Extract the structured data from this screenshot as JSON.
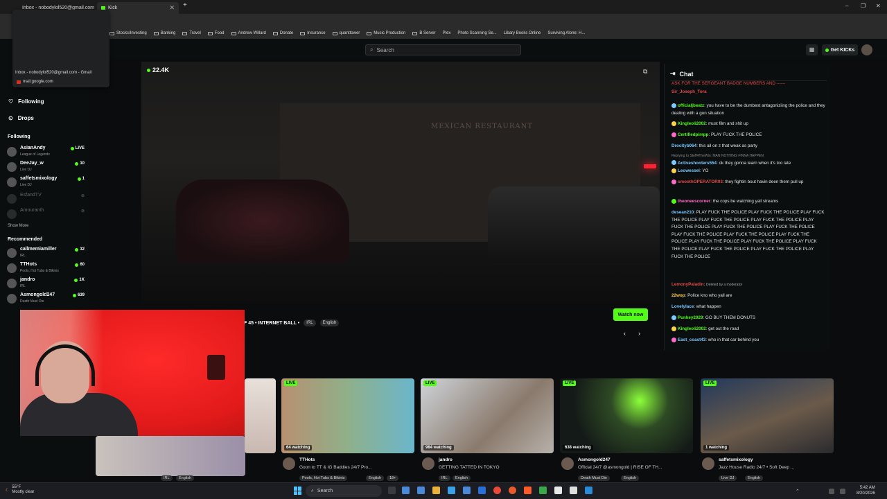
{
  "browser": {
    "tabs": [
      {
        "label": "Inbox - nobodylol520@gmail.com",
        "active": false
      },
      {
        "label": "Kick",
        "active": true
      }
    ],
    "new_tab": "+",
    "window_controls": [
      "–",
      "❐",
      "✕"
    ],
    "bookmarks": [
      "Stocks/Investing",
      "Banking",
      "Travel",
      "Food",
      "Andrew Willard",
      "Donate",
      "Insurance",
      "quanttower",
      "Music Production",
      "B Server",
      "Plex",
      "Photo Scanning Se...",
      "Libary Books Online",
      "Surviving Alone: H..."
    ]
  },
  "tab_tooltip": {
    "title": "Inbox - nobodylol520@gmail.com - Gmail",
    "domain": "mail.google.com"
  },
  "topbar": {
    "search_placeholder": "Search",
    "get_kicks": "Get KICKs"
  },
  "sidebar": {
    "nav": [
      {
        "label": "Following",
        "icon": "heart-icon"
      },
      {
        "label": "Drops",
        "icon": "drops-icon"
      }
    ],
    "following_title": "Following",
    "following": [
      {
        "name": "AsianAndy",
        "category": "League of Legends",
        "viewers": "LIVE",
        "online": true
      },
      {
        "name": "DeeJay_w",
        "category": "Live DJ",
        "viewers": "10",
        "online": true
      },
      {
        "name": "saffetsmixology",
        "category": "Live DJ",
        "viewers": "1",
        "online": true
      },
      {
        "name": "EsfandTV",
        "category": "",
        "viewers": "",
        "online": false
      },
      {
        "name": "Amouranth",
        "category": "",
        "viewers": "",
        "online": false
      }
    ],
    "show_more": "Show More",
    "recommended_title": "Recommended",
    "recommended": [
      {
        "name": "callmemiamiller",
        "category": "IRL",
        "viewers": "32"
      },
      {
        "name": "TTHots",
        "category": "Pools, Hot Tubs & Bikinis",
        "viewers": "60"
      },
      {
        "name": "jandro",
        "category": "IRL",
        "viewers": "1K"
      },
      {
        "name": "Asmongold247",
        "category": "Death Must Die",
        "viewers": "639"
      }
    ]
  },
  "player": {
    "viewers": "22.4K",
    "title": "F 45 • INTERNET BALL •",
    "tags": [
      "IRL",
      "English"
    ],
    "watch_now": "Watch now",
    "prev": "‹",
    "next": "›"
  },
  "chat": {
    "title": "Chat",
    "messages": [
      {
        "user": "",
        "text": "ASK FOR THE SERGEANT BADGE NUMBERS AND ------",
        "color": "#e24b4b"
      },
      {
        "user": "Sir_Joseph_Tora",
        "text": "",
        "color": "#e24b4b"
      },
      {
        "user": "officialjbeatz",
        "text": "you have to be the dumbest antagoniziing the police and they dealing with a gun situation",
        "color": "#53fc18"
      },
      {
        "user": "Kingleoli2002",
        "text": "must film and shit up",
        "color": "#53fc18"
      },
      {
        "user": "Certifiedpimpp",
        "text": "PLAY FUCK THE POLICE",
        "color": "#53fc18"
      },
      {
        "user": "Drocityb064",
        "text": "this all on z that weak as party",
        "color": "#7cc8ff"
      },
      {
        "user": "Activeshooters554",
        "text": "ok they gonna learn when it's too late",
        "color": "#7cc8ff",
        "reply": "Replying to Steff4TheWin: MAN NOTHING FINNA HAPPEN"
      },
      {
        "user": "Leowessel",
        "text": "YO",
        "color": "#7cc8ff"
      },
      {
        "user": "smoothOPERATOR93",
        "text": "they fightin bout havin deen them pull up",
        "color": "#e24b4b"
      },
      {
        "user": "theoneescorner",
        "text": "the cops be watching yall streams",
        "color": "#ff69c8"
      },
      {
        "user": "desean210",
        "text": "PLAY FUCK THE POLICE PLAY FUCK THE POLICE PLAY FUCK THE POLICE PLAY FUCK THE POLICE PLAY FUCK THE POLICE PLAY FUCK THE POLICE PLAY FUCK THE POLICE PLAY FUCK THE POLICE PLAY FUCK THE POLICE PLAY FUCK THE POLICE PLAY FUCK THE POLICE PLAY FUCK THE POLICE PLAY FUCK THE POLICE PLAY FUCK THE POLICE PLAY FUCK THE POLICE PLAY FUCK THE POLICE PLAY FUCK THE POLICE",
        "color": "#7cc8ff"
      },
      {
        "user": "LemonyPaladin",
        "text": "Deleted by a moderator",
        "color": "#e24b4b"
      },
      {
        "user": "22wop",
        "text": "Police kno who yall are",
        "color": "#ffd24a"
      },
      {
        "user": "Lovelylace",
        "text": "what happen",
        "color": "#7cc8ff"
      },
      {
        "user": "Punkey2029",
        "text": "GO BUY THEM DONUTS",
        "color": "#53fc18"
      },
      {
        "user": "Kingleoli2002",
        "text": "get out the road",
        "color": "#53fc18"
      },
      {
        "user": "East_coast43",
        "text": "who in that car behind you",
        "color": "#7cc8ff"
      }
    ]
  },
  "cards": [
    {
      "live": "LIVE",
      "watching": "64 watching",
      "name": "TTHots",
      "title": "Goon to TT & IG Baddies 24/7 Pro...",
      "tags": [
        "Pools, Hot Tubs & Bikinis",
        "English",
        "18+"
      ]
    },
    {
      "live": "LIVE",
      "watching": "984 watching",
      "name": "jandro",
      "title": "GETTING TATTED IN TOKYO",
      "tags": [
        "IRL",
        "English"
      ]
    },
    {
      "live": "LIVE",
      "watching": "638 watching",
      "name": "Asmongold247",
      "title": "Official 24/7 @asmongold | RISE OF TH...",
      "tags": [
        "Death Must Die",
        "English"
      ]
    },
    {
      "live": "LIVE",
      "watching": "1 watching",
      "name": "saffetsmixology",
      "title": "Jazz House Radio 24/7 • Soft Deep ...",
      "tags": [
        "Live DJ",
        "English"
      ]
    }
  ],
  "partial_card_tags": [
    "IRL",
    "English"
  ],
  "taskbar": {
    "weather_temp": "55°F",
    "weather_desc": "Mostly clear",
    "search": "Search",
    "time": "5:42 AM",
    "date": "8/20/2026"
  }
}
